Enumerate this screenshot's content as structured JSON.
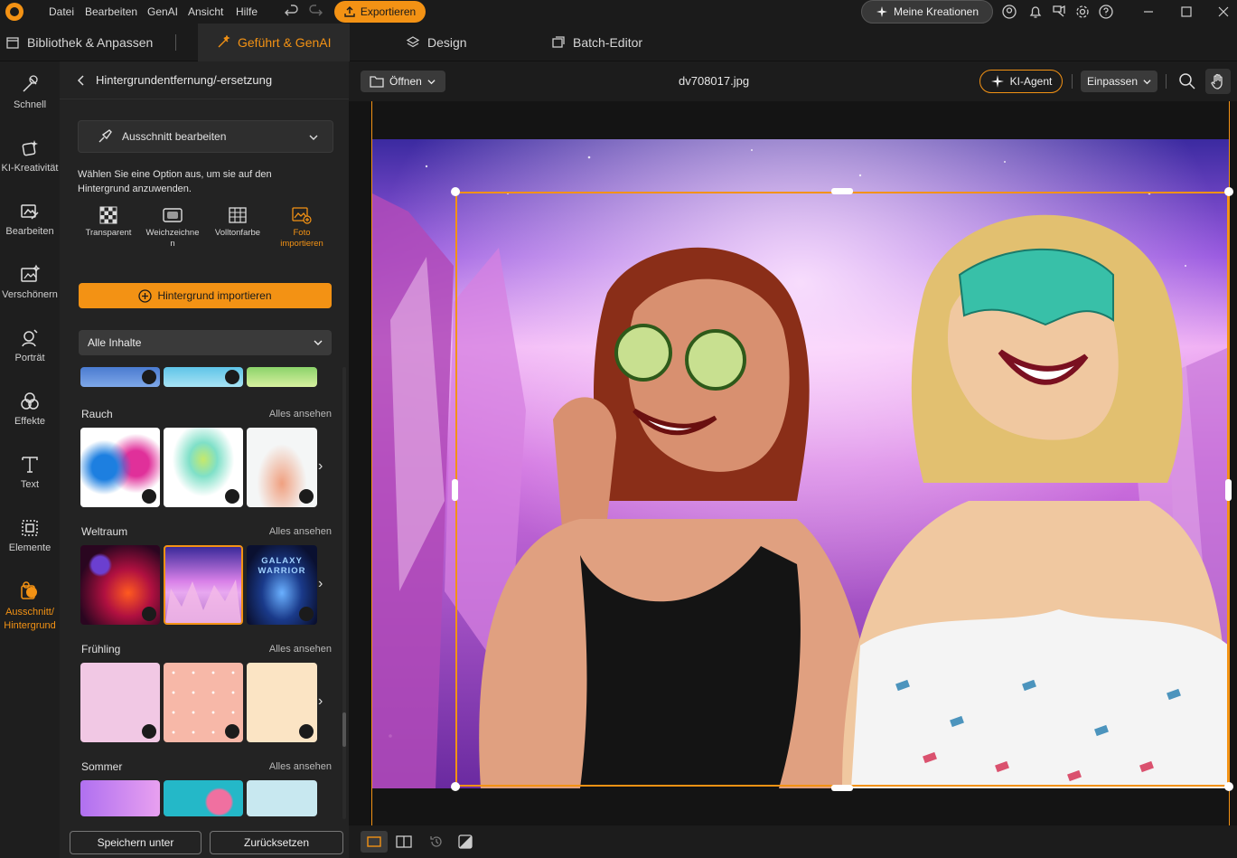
{
  "menu": {
    "items": [
      "Datei",
      "Bearbeiten",
      "GenAI",
      "Ansicht",
      "Hilfe"
    ]
  },
  "toolbar": {
    "export_label": "Exportieren",
    "creations_label": "Meine Kreationen"
  },
  "modes": {
    "library": "Bibliothek & Anpassen",
    "guided": "Geführt & GenAI",
    "design": "Design",
    "batch": "Batch-Editor"
  },
  "rail": [
    {
      "label": "Schnell",
      "icon": "magic-wand-icon"
    },
    {
      "label": "KI-Kreativität",
      "icon": "ai-creativity-icon"
    },
    {
      "label": "Bearbeiten",
      "icon": "edit-image-icon"
    },
    {
      "label": "Verschönern",
      "icon": "beautify-icon"
    },
    {
      "label": "Porträt",
      "icon": "portrait-icon"
    },
    {
      "label": "Effekte",
      "icon": "effects-icon"
    },
    {
      "label": "Text",
      "icon": "text-icon"
    },
    {
      "label": "Elemente",
      "icon": "elements-icon"
    },
    {
      "label": "Ausschnitt/ Hintergrund",
      "icon": "cutout-background-icon"
    }
  ],
  "panel": {
    "title": "Hintergrundentfernung/-ersetzung",
    "cutout_label": "Ausschnitt bearbeiten",
    "hint": "Wählen Sie eine Option aus, um sie auf den Hintergrund anzuwenden.",
    "options": [
      "Transparent",
      "Weichzeichne n",
      "Volltonfarbe",
      "Foto importieren"
    ],
    "import_label": "Hintergrund importieren",
    "filter_label": "Alle Inhalte",
    "see_all": "Alles ansehen",
    "sections": [
      "Rauch",
      "Weltraum",
      "Frühling",
      "Sommer"
    ],
    "save_label": "Speichern unter",
    "reset_label": "Zurücksetzen"
  },
  "canvas": {
    "open_label": "Öffnen",
    "file_name": "dv708017.jpg",
    "agent_label": "KI-Agent",
    "fit_label": "Einpassen"
  },
  "thumb_text": {
    "galaxy": "GALAXY WARRIOR"
  },
  "colors": {
    "accent": "#f39214",
    "background": "#1b1b1b",
    "panel": "#232323"
  }
}
